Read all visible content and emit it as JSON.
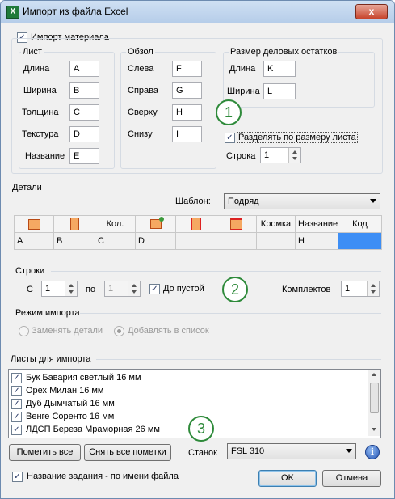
{
  "window": {
    "title": "Импорт из файла Excel",
    "app_icon": "X",
    "close": "x"
  },
  "import_material": {
    "label": "Импорт материала",
    "checked": true
  },
  "sheet": {
    "title": "Лист",
    "length_label": "Длина",
    "length_value": "A",
    "width_label": "Ширина",
    "width_value": "B",
    "thickness_label": "Толщина",
    "thickness_value": "C",
    "texture_label": "Текстура",
    "texture_value": "D",
    "name_label": "Название",
    "name_value": "E"
  },
  "trim": {
    "title": "Обзол",
    "left_label": "Слева",
    "left_value": "F",
    "right_label": "Справа",
    "right_value": "G",
    "top_label": "Сверху",
    "top_value": "H",
    "bottom_label": "Снизу",
    "bottom_value": "I"
  },
  "offcuts": {
    "title": "Размер деловых остатков",
    "length_label": "Длина",
    "length_value": "K",
    "width_label": "Ширина",
    "width_value": "L",
    "split_label": "Разделять по размеру листа",
    "split_checked": true,
    "row_label": "Строка",
    "row_value": "1"
  },
  "callouts": [
    "1",
    "2",
    "3"
  ],
  "details": {
    "title": "Детали",
    "template_label": "Шаблон:",
    "template_value": "Подряд",
    "headers": [
      "",
      "",
      "Кол.",
      "",
      "",
      "",
      "Кромка",
      "Название",
      "Код"
    ],
    "row": [
      "A",
      "B",
      "C",
      "D",
      "",
      "",
      "",
      "H",
      ""
    ]
  },
  "rows": {
    "title": "Строки",
    "from_label": "С",
    "from_value": "1",
    "to_label": "по",
    "to_value": "1",
    "until_empty_label": "До пустой",
    "until_empty_checked": true,
    "sets_label": "Комплектов",
    "sets_value": "1"
  },
  "import_mode": {
    "title": "Режим импорта",
    "replace_label": "Заменять детали",
    "append_label": "Добавлять в список"
  },
  "sheets_to_import": {
    "title": "Листы для импорта",
    "items": [
      "Бук Бавария светлый 16 мм",
      "Орех Милан 16 мм",
      "Дуб Дымчатый 16 мм",
      "Венге Соренто 16 мм",
      "ЛДСП Береза Мраморная 26 мм"
    ]
  },
  "buttons": {
    "check_all": "Пометить все",
    "uncheck_all": "Снять все пометки",
    "ok": "OK",
    "cancel": "Отмена"
  },
  "machine": {
    "label": "Станок",
    "value": "FSL 310"
  },
  "task_name": {
    "label": "Название задания - по имени файла",
    "checked": true
  },
  "colors": {
    "selected_cell": "#3d8ef5",
    "callout": "#2e8a3a"
  }
}
